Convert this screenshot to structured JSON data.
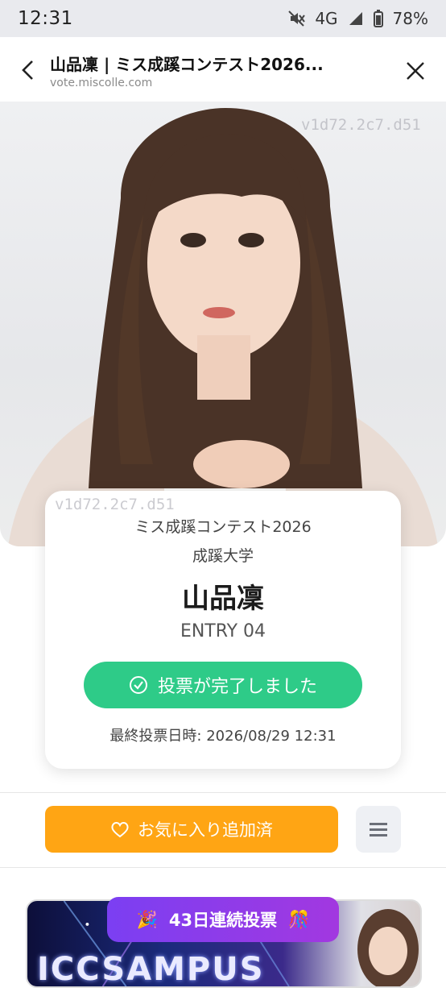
{
  "status_bar": {
    "time": "12:31",
    "network": "4G",
    "battery": "78%"
  },
  "header": {
    "title": "山品凜 | ミス成蹊コンテスト2026...",
    "url": "vote.miscolle.com"
  },
  "hero": {
    "watermark_top": "v1d72.2c7.d51",
    "watermark_card": "v1d72.2c7.d51"
  },
  "card": {
    "contest": "ミス成蹊コンテスト2026",
    "university": "成蹊大学",
    "name": "山品凜",
    "entry": "ENTRY 04",
    "vote_button": "投票が完了しました",
    "last_vote": "最終投票日時: 2026/08/29 12:31"
  },
  "actions": {
    "favorite": "お気に入り追加済"
  },
  "banner": {
    "streak": "43日連続投票",
    "text": "ICCSAMPUS"
  },
  "colors": {
    "vote_green": "#2ecb88",
    "favorite_orange": "#ffa514",
    "streak_purple": "#8b3cf0"
  }
}
